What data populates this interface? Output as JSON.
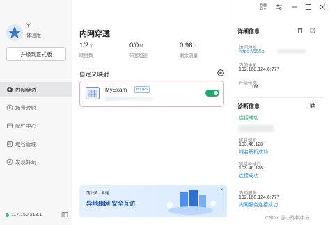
{
  "sidebar": {
    "user_initial": "Y",
    "edition": "体验版",
    "upgrade_label": "升级到正式版",
    "nav": [
      {
        "label": "内网穿透",
        "icon": "eye-icon",
        "active": true
      },
      {
        "label": "场景映射",
        "icon": "play-icon",
        "active": false
      },
      {
        "label": "配件中心",
        "icon": "box-icon",
        "active": false
      },
      {
        "label": "域名管理",
        "icon": "domain-icon",
        "active": false
      },
      {
        "label": "发现好玩",
        "icon": "discover-icon",
        "active": false
      }
    ],
    "ip": "117.150.213.1"
  },
  "main": {
    "title": "内网穿透",
    "stats": [
      {
        "value": "1/2",
        "unit": "个",
        "label": "映射数"
      },
      {
        "value": "0/0",
        "unit": "M",
        "label": "带宽加速"
      },
      {
        "value": "0.98",
        "unit": "G",
        "label": "剩余流量"
      }
    ],
    "section_title": "自定义映射",
    "mapping": {
      "name": "MyExam",
      "badge": "HTTPS",
      "enabled": true
    },
    "banner": {
      "brand": "蒲公英 · 易连",
      "text": "异地组网  安全互访"
    }
  },
  "panel": {
    "details_title": "详细信息",
    "access_label": "访问地址",
    "access_value": "https://555o",
    "host_label": "内网主机",
    "host_value": "192.168.124.6:777",
    "bw_label": "升级带宽",
    "bw_value": "1M",
    "diag_title": "诊断信息",
    "conn_status": "连接成功",
    "domain_label": "域名解析",
    "domain_ip": "103.46.128",
    "domain_status": "域名解析成功",
    "port_label": "映射IP端口",
    "port_ip": "103.46.128",
    "port_status": "连接成功",
    "svc_label": "内网服务",
    "svc_value": "192.168.124.6:777",
    "svc_status": "内网服务连接成功",
    "watermark": "CSDN @小熊桃中分"
  },
  "colors": {
    "accent": "#1faa6a",
    "link": "#1e88e5",
    "active_bg": "#e6e6e9",
    "card_border": "#f0a9b6"
  }
}
